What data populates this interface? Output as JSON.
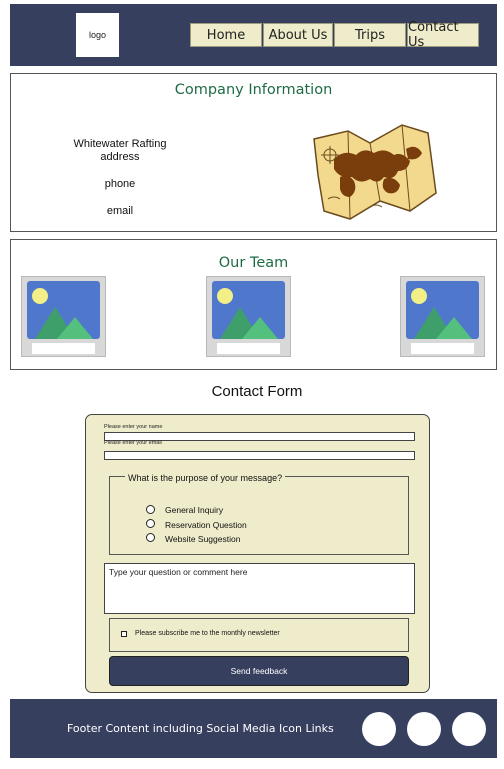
{
  "header": {
    "logo_text": "logo",
    "nav": [
      "Home",
      "About Us",
      "Trips",
      "Contact Us"
    ]
  },
  "company": {
    "title": "Company Information",
    "name": "Whitewater Rafting",
    "address": "address",
    "phone": "phone",
    "email": "email",
    "image_icon": "treasure-map-icon"
  },
  "team": {
    "title": "Our Team",
    "photo_icon": "image-placeholder-icon"
  },
  "form": {
    "title": "Contact Form",
    "name_label": "Please enter your name",
    "email_label": "Please enter your email",
    "purpose_legend": "What is the purpose of your message?",
    "options": [
      "General Inquiry",
      "Reservation Question",
      "Website Suggestion"
    ],
    "comment_placeholder": "Type your question or comment here",
    "newsletter_label": "Please subscribe me to the monthly newsletter",
    "submit_label": "Send feedback"
  },
  "footer": {
    "text": "Footer Content including Social Media Icon Links",
    "social_icons": [
      "social-icon",
      "social-icon",
      "social-icon"
    ]
  },
  "colors": {
    "navy": "#373f5f",
    "cream": "#efeccb",
    "title_green": "#1f6b45"
  }
}
